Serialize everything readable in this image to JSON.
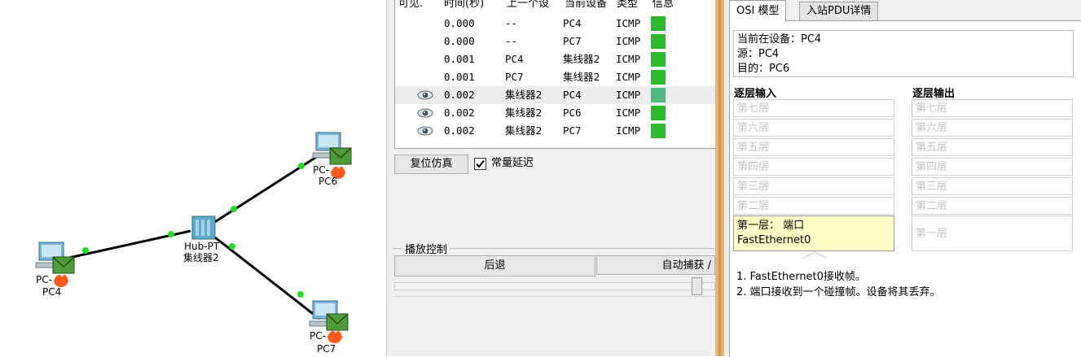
{
  "topology": {
    "nodes": [
      {
        "id": "pc6",
        "type_label": "PC-",
        "name": "PC6"
      },
      {
        "id": "pc4",
        "type_label": "PC-",
        "name": "PC4"
      },
      {
        "id": "pc7",
        "type_label": "PC-",
        "name": "PC7"
      },
      {
        "id": "hub",
        "type_label": "Hub-PT",
        "name": "集线器2"
      }
    ]
  },
  "event_list": {
    "columns": [
      "可见.",
      "时间(秒)",
      "上一个设",
      "当前设备",
      "类型",
      "信息"
    ],
    "rows": [
      {
        "visible": "",
        "time": "0.000",
        "last": "--",
        "current": "PC4",
        "type": "ICMP",
        "color": "#2db82d"
      },
      {
        "visible": "",
        "time": "0.000",
        "last": "--",
        "current": "PC7",
        "type": "ICMP",
        "color": "#2db82d"
      },
      {
        "visible": "",
        "time": "0.001",
        "last": "PC4",
        "current": "集线器2",
        "type": "ICMP",
        "color": "#2db82d"
      },
      {
        "visible": "",
        "time": "0.001",
        "last": "PC7",
        "current": "集线器2",
        "type": "ICMP",
        "color": "#2db82d"
      },
      {
        "visible": "eye-icon",
        "time": "0.002",
        "last": "集线器2",
        "current": "PC4",
        "type": "ICMP",
        "color": "#4fb880"
      },
      {
        "visible": "eye-icon",
        "time": "0.002",
        "last": "集线器2",
        "current": "PC6",
        "type": "ICMP",
        "color": "#2db82d"
      },
      {
        "visible": "eye-icon",
        "time": "0.002",
        "last": "集线器2",
        "current": "PC7",
        "type": "ICMP",
        "color": "#2db82d"
      }
    ],
    "reset_button": "复位仿真",
    "constant_delay_label": "常量延迟",
    "constant_delay_checked": true
  },
  "playback": {
    "title": "播放控制",
    "back_button": "后退",
    "auto_capture_button": "自动捕获 /"
  },
  "pdu": {
    "tabs": [
      "OSI 模型",
      "入站PDU详情"
    ],
    "info": {
      "current_device": "当前在设备：PC4",
      "source": "源：PC4",
      "destination": "目的：PC6"
    },
    "in_header": "逐层输入",
    "out_header": "逐层输出",
    "in_layers": [
      "第七层",
      "第六层",
      "第五层",
      "第四层",
      "第三层",
      "第二层"
    ],
    "out_layers": [
      "第七层",
      "第六层",
      "第五层",
      "第四层",
      "第三层",
      "第二层"
    ],
    "layer1_in_line1": "第一层：  端口",
    "layer1_in_line2": "FastEthernet0",
    "layer1_out": "第一层",
    "descriptions": [
      "1. FastEthernet0接收帧。",
      "2. 端口接收到一个碰撞帧。设备将其丢弃。"
    ]
  },
  "colors": {
    "accent_green": "#2db82d",
    "splitter": "#e8b477",
    "highlight_layer": "#ffffc8"
  }
}
